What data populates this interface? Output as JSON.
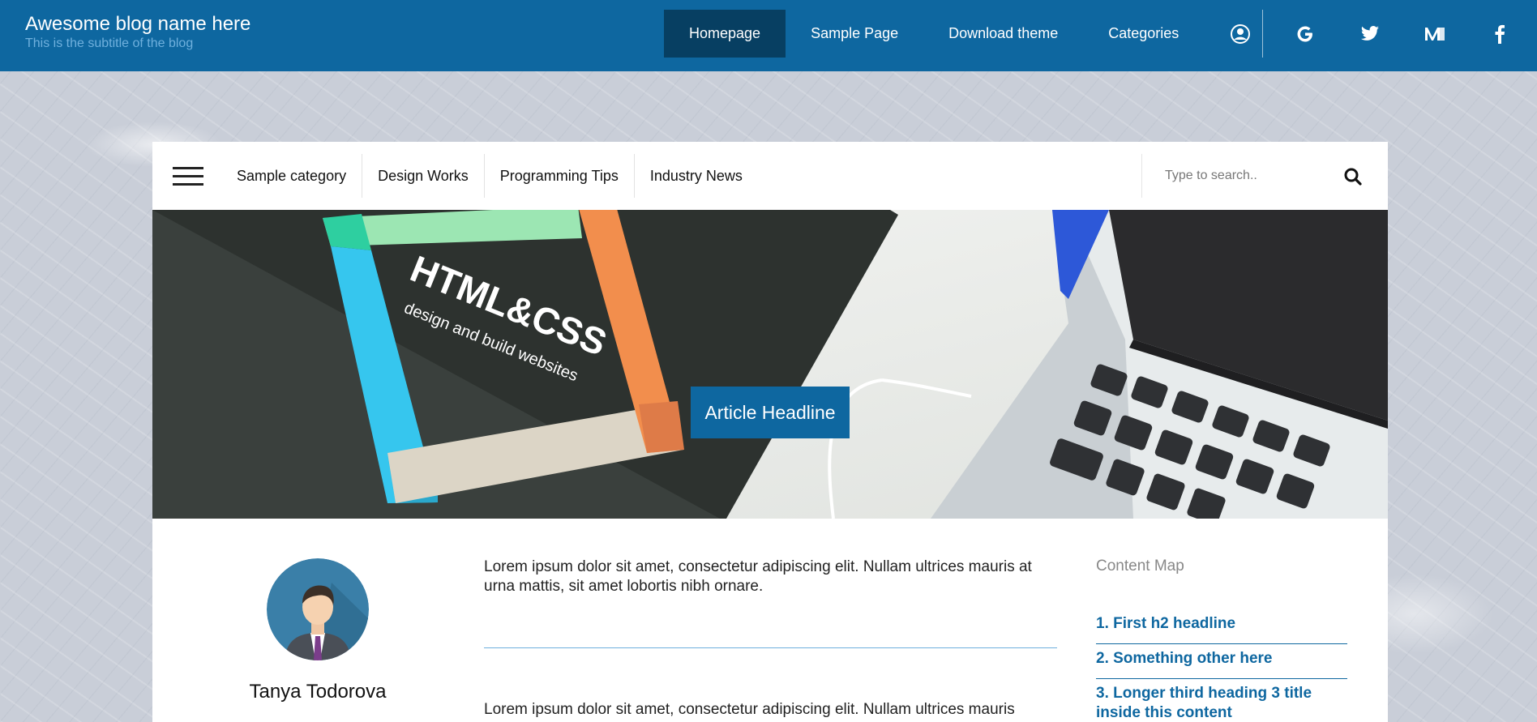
{
  "header": {
    "blog_title": "Awesome blog name here",
    "blog_subtitle": "This is the subtitle of the blog",
    "nav": [
      "Homepage",
      "Sample Page",
      "Download theme",
      "Categories"
    ],
    "active_nav": "Homepage",
    "icons": [
      "user-icon",
      "google-icon",
      "twitter-icon",
      "medium-icon",
      "facebook-icon"
    ]
  },
  "categories": {
    "items": [
      "Sample category",
      "Design Works",
      "Programming Tips",
      "Industry News"
    ]
  },
  "search": {
    "placeholder": "Type to search.."
  },
  "hero": {
    "headline": "Article Headline",
    "book_title": "HTML&CSS",
    "book_subtitle": "design and build websites"
  },
  "author": {
    "name": "Tanya Todorova"
  },
  "article": {
    "paragraph1": "Lorem ipsum dolor sit amet, consectetur adipiscing elit. Nullam ultrices mauris at urna mattis, sit amet lobortis nibh ornare.",
    "paragraph2": "Lorem ipsum dolor sit amet, consectetur adipiscing elit. Nullam ultrices mauris"
  },
  "content_map": {
    "title": "Content Map",
    "items": [
      "1. First h2 headline",
      "2. Something other here",
      "3. Longer third heading 3 title inside this content"
    ]
  },
  "colors": {
    "primary": "#0e67a0",
    "active_nav": "#073f62",
    "accent_light": "#6fb0dd"
  }
}
